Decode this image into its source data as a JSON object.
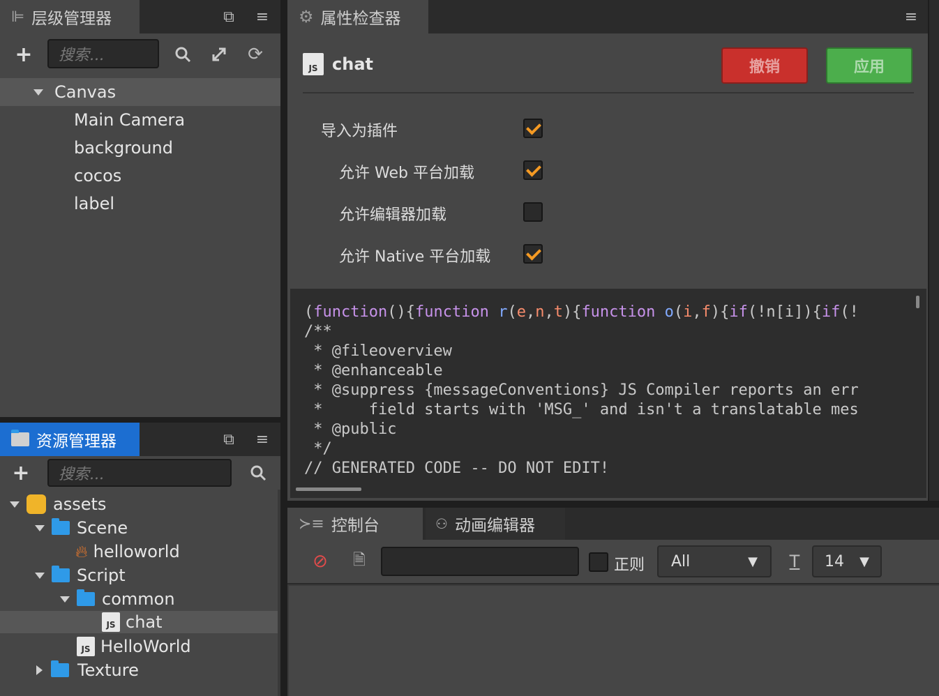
{
  "colors": {
    "revert": "#c9302c",
    "apply": "#4cae4c",
    "checkmark": "#f59a23",
    "tab_active_blue": "#1c6ed1",
    "folder": "#2f9ae8"
  },
  "hierarchy": {
    "title": "层级管理器",
    "search_placeholder": "搜索...",
    "root": "Canvas",
    "children": [
      "Main Camera",
      "background",
      "cocos",
      "label"
    ]
  },
  "assets": {
    "title": "资源管理器",
    "search_placeholder": "搜索...",
    "tree": [
      {
        "label": "assets",
        "icon": "assets-icon"
      },
      {
        "label": "Scene",
        "icon": "folder-icon"
      },
      {
        "label": "helloworld",
        "icon": "scene-fire-icon"
      },
      {
        "label": "Script",
        "icon": "folder-icon"
      },
      {
        "label": "common",
        "icon": "folder-icon"
      },
      {
        "label": "chat",
        "icon": "js-icon"
      },
      {
        "label": "HelloWorld",
        "icon": "js-icon"
      },
      {
        "label": "Texture",
        "icon": "folder-icon"
      }
    ]
  },
  "inspector": {
    "title": "属性检查器",
    "file_name": "chat",
    "js_badge": "JS",
    "revert_label": "撤销",
    "apply_label": "应用",
    "props": [
      {
        "label": "导入为插件",
        "checked": true
      },
      {
        "label": "允许 Web 平台加载",
        "checked": true
      },
      {
        "label": "允许编辑器加载",
        "checked": false
      },
      {
        "label": "允许 Native 平台加载",
        "checked": true
      }
    ],
    "code_lines": [
      "/**",
      " * @fileoverview",
      " * @enhanceable",
      " * @suppress {messageConventions} JS Compiler reports an err",
      " *     field starts with 'MSG_' and isn't a translatable mes",
      " * @public",
      " */",
      "// GENERATED CODE -- DO NOT EDIT!"
    ]
  },
  "console": {
    "tab_console": "控制台",
    "tab_animation": "动画编辑器",
    "regex_label": "正则",
    "level_value": "All",
    "font_size_value": "14"
  }
}
